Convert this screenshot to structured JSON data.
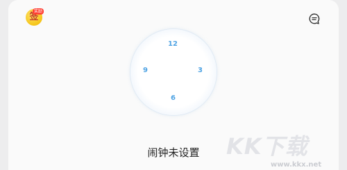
{
  "header": {
    "signin": {
      "glyph": "签",
      "badge": "奖励"
    },
    "feedback_icon": "chat-bubble-icon"
  },
  "clock": {
    "n12": "12",
    "n3": "3",
    "n6": "6",
    "n9": "9"
  },
  "status": {
    "text": "闹钟未设置"
  },
  "watermark": {
    "logo": "KK下载",
    "url": "www.kkx.net"
  }
}
